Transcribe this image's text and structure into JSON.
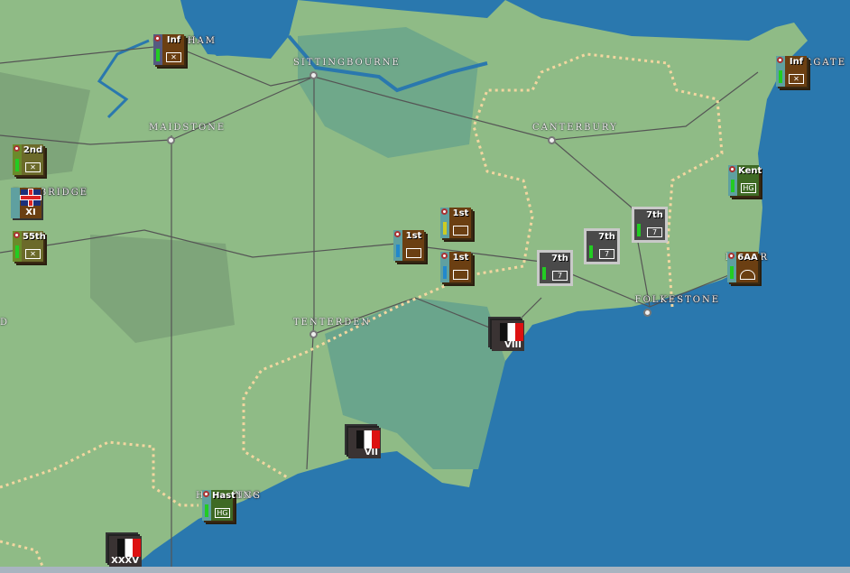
{
  "map": {
    "colors": {
      "sea": "#2a78ae",
      "land": "#8fbb86",
      "forest": "#6fa88a",
      "supply_line": "#f2d6a0"
    },
    "cities": [
      {
        "name": "CHATHAM",
        "shown": "HAM"
      },
      {
        "name": "SITTINGBOURNE"
      },
      {
        "name": "MAIDSTONE"
      },
      {
        "name": "CANTERBURY"
      },
      {
        "name": "TONBRIDGE",
        "shown": "RIDGE"
      },
      {
        "name": "TENTERDEN"
      },
      {
        "name": "FOLKESTONE",
        "shown": "OLKESTONE"
      },
      {
        "name": "MARGATE",
        "shown": "GATE"
      },
      {
        "name": "HASTINGS",
        "shown": "ING"
      },
      {
        "name": "DOVER",
        "shown": "R"
      },
      {
        "name": "ASHFORD",
        "shown": "D"
      }
    ]
  },
  "units": {
    "allied": [
      {
        "label": "Inf",
        "type": "infantry",
        "color": "brown"
      },
      {
        "label": "2nd",
        "type": "infantry",
        "color": "olive"
      },
      {
        "label": "XI",
        "type": "corps-hq",
        "nation": "UK"
      },
      {
        "label": "55th",
        "type": "infantry",
        "color": "olive"
      },
      {
        "label": "1st",
        "type": "armor",
        "color": "brown"
      },
      {
        "label": "1st",
        "type": "armor",
        "color": "brown"
      },
      {
        "label": "1st",
        "type": "armor",
        "color": "brown"
      },
      {
        "label": "Inf",
        "type": "infantry",
        "color": "brown"
      },
      {
        "label": "Kent",
        "type": "home-guard",
        "symbol": "HG",
        "color": "green"
      },
      {
        "label": "6AA",
        "type": "anti-air",
        "color": "brown"
      },
      {
        "label": "Hast",
        "type": "home-guard",
        "symbol": "HG",
        "color": "green"
      }
    ],
    "enemy_disrupted": [
      {
        "label": "7th",
        "symbol": "7"
      },
      {
        "label": "7th",
        "symbol": "7"
      },
      {
        "label": "7th",
        "symbol": "7"
      }
    ],
    "german_corps": [
      {
        "label": "VIII"
      },
      {
        "label": "VII"
      },
      {
        "label": "XXXV"
      }
    ]
  }
}
